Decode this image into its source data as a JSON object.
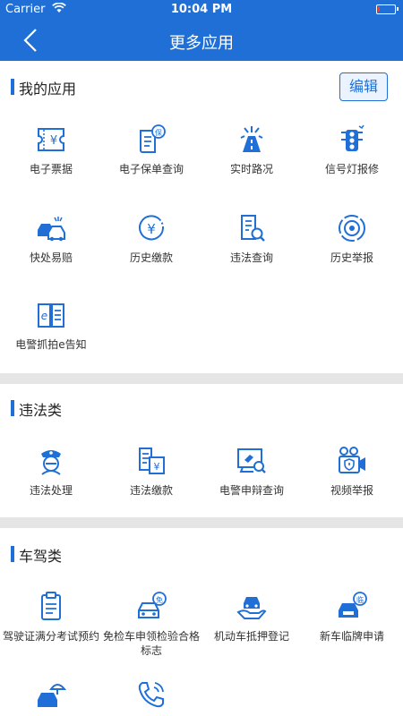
{
  "status_bar": {
    "carrier": "Carrier",
    "time": "10:04 PM",
    "battery_level": 0.1
  },
  "nav": {
    "title": "更多应用"
  },
  "my_apps": {
    "title": "我的应用",
    "edit_label": "编辑",
    "items": [
      {
        "label": "电子票据",
        "icon": "ticket-icon"
      },
      {
        "label": "电子保单查询",
        "icon": "policy-icon"
      },
      {
        "label": "实时路况",
        "icon": "road-icon"
      },
      {
        "label": "信号灯报修",
        "icon": "traffic-light-icon"
      },
      {
        "label": "快处易赔",
        "icon": "car-accident-icon"
      },
      {
        "label": "历史缴款",
        "icon": "history-payment-icon"
      },
      {
        "label": "违法查询",
        "icon": "document-search-icon"
      },
      {
        "label": "历史举报",
        "icon": "history-report-icon"
      },
      {
        "label": "电警抓拍e告知",
        "icon": "e-notice-icon"
      }
    ]
  },
  "violations": {
    "title": "违法类",
    "items": [
      {
        "label": "违法处理",
        "icon": "police-icon"
      },
      {
        "label": "违法缴款",
        "icon": "payment-doc-icon"
      },
      {
        "label": "电警申辩查询",
        "icon": "camera-search-icon"
      },
      {
        "label": "视频举报",
        "icon": "video-report-icon"
      }
    ]
  },
  "driving": {
    "title": "车驾类",
    "items": [
      {
        "label": "驾驶证满分考试预约",
        "icon": "clipboard-icon"
      },
      {
        "label": "免检车申领检验合格标志",
        "icon": "exempt-car-icon"
      },
      {
        "label": "机动车抵押登记",
        "icon": "car-hand-icon"
      },
      {
        "label": "新车临牌申请",
        "icon": "temp-plate-car-icon"
      },
      {
        "label": "",
        "icon": "car-umbrella-icon"
      },
      {
        "label": "",
        "icon": "phone-icon"
      }
    ]
  },
  "colors": {
    "brand": "#1f6fd6",
    "band": "#e5e5e5",
    "battery": "#ff3b30"
  }
}
